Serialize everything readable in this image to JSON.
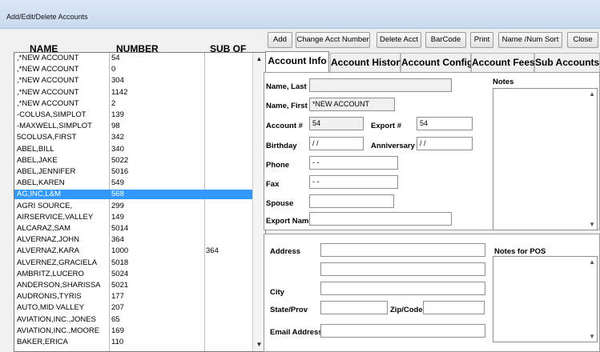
{
  "window": {
    "title": "Add/Edit/Delete Accounts"
  },
  "list": {
    "headers": {
      "name": "NAME",
      "number": "NUMBER",
      "sub_of": "SUB OF"
    },
    "rows": [
      {
        "name": ",*NEW ACCOUNT",
        "number": "54",
        "sub": ""
      },
      {
        "name": ",*NEW ACCOUNT",
        "number": "0",
        "sub": ""
      },
      {
        "name": ",*NEW ACCOUNT",
        "number": "304",
        "sub": ""
      },
      {
        "name": ",*NEW ACCOUNT",
        "number": "1142",
        "sub": ""
      },
      {
        "name": ",*NEW ACCOUNT",
        "number": "2",
        "sub": ""
      },
      {
        "name": "-COLUSA,SIMPLOT",
        "number": "139",
        "sub": ""
      },
      {
        "name": "-MAXWELL,SIMPLOT",
        "number": "98",
        "sub": ""
      },
      {
        "name": "5COLUSA,FIRST",
        "number": "342",
        "sub": ""
      },
      {
        "name": "ABEL,BILL",
        "number": "340",
        "sub": ""
      },
      {
        "name": "ABEL,JAKE",
        "number": "5022",
        "sub": ""
      },
      {
        "name": "ABEL,JENNIFER",
        "number": "5016",
        "sub": ""
      },
      {
        "name": "ABEL,KAREN",
        "number": "549",
        "sub": ""
      },
      {
        "name": "AG,INC,L&M",
        "number": "568",
        "sub": "",
        "selected": true
      },
      {
        "name": "AGRI SOURCE,",
        "number": "299",
        "sub": ""
      },
      {
        "name": "AIRSERVICE,VALLEY",
        "number": "149",
        "sub": ""
      },
      {
        "name": "ALCARAZ,SAM",
        "number": "5014",
        "sub": ""
      },
      {
        "name": "ALVERNAZ,JOHN",
        "number": "364",
        "sub": ""
      },
      {
        "name": "ALVERNAZ,KARA",
        "number": "1000",
        "sub": "364"
      },
      {
        "name": "ALVERNEZ,GRACIELA",
        "number": "5018",
        "sub": ""
      },
      {
        "name": "AMBRITZ,LUCERO",
        "number": "5024",
        "sub": ""
      },
      {
        "name": "ANDERSON,SHARISSA",
        "number": "5021",
        "sub": ""
      },
      {
        "name": "AUDRONIS,TYRIS",
        "number": "177",
        "sub": ""
      },
      {
        "name": "AUTO,MID VALLEY",
        "number": "207",
        "sub": ""
      },
      {
        "name": "AVIATION,INC.,JONES",
        "number": "65",
        "sub": ""
      },
      {
        "name": "AVIATION,INC.,MOORE",
        "number": "169",
        "sub": ""
      },
      {
        "name": "BAKER,ERICA",
        "number": "110",
        "sub": ""
      }
    ]
  },
  "toolbar": {
    "add": "Add",
    "change_acct_number": "Change Acct Number",
    "delete_acct": "Delete Acct",
    "barcode": "BarCode",
    "print": "Print",
    "name_num_sort": "Name /Num  Sort",
    "close": "Close"
  },
  "tabs": {
    "account_info": "Account Info",
    "account_history": "Account History",
    "account_config": "Account Config",
    "account_fees": "Account Fees",
    "sub_accounts": "Sub Accounts"
  },
  "form": {
    "name_last": {
      "label": "Name, Last",
      "value": ""
    },
    "name_first": {
      "label": "Name, First",
      "value": "*NEW ACCOUNT"
    },
    "account_num": {
      "label": "Account #",
      "value": "54"
    },
    "export_num": {
      "label": "Export #",
      "value": "54"
    },
    "birthday": {
      "label": "Birthday",
      "value": "/ /"
    },
    "anniversary": {
      "label": "Anniversary",
      "value": "/ /"
    },
    "phone": {
      "label": "Phone",
      "value": "-  -"
    },
    "fax": {
      "label": "Fax",
      "value": "-  -"
    },
    "spouse": {
      "label": "Spouse",
      "value": ""
    },
    "export_name": {
      "label": "Export Name",
      "value": ""
    },
    "notes_label": "Notes",
    "address": {
      "label": "Address",
      "line1": "",
      "line2": ""
    },
    "city": {
      "label": "City",
      "value": ""
    },
    "state": {
      "label": "State/Prov",
      "value": ""
    },
    "zip": {
      "label": "Zip/Code",
      "value": ""
    },
    "email": {
      "label": "Email Address",
      "value": ""
    },
    "notes_pos_label": "Notes for POS"
  }
}
